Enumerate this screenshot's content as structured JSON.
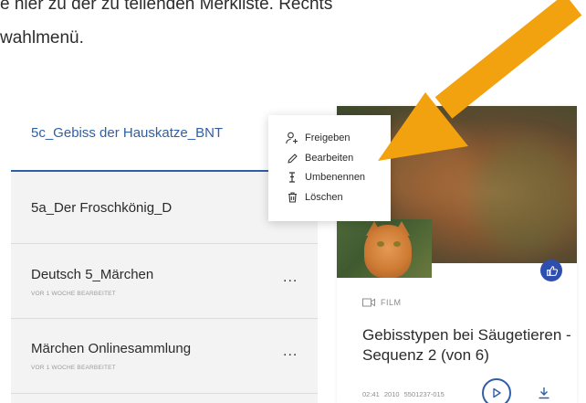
{
  "intro": {
    "line1": "e hier zu der zu teilenden Merkliste. Rechts",
    "line2": "wahlmenü."
  },
  "list": {
    "items": [
      {
        "title": "5c_Gebiss der Hauskatze_BNT",
        "sub": "",
        "active": true
      },
      {
        "title": "5a_Der Froschkönig_D",
        "sub": ""
      },
      {
        "title": "Deutsch 5_Märchen",
        "sub": "VOR 1 WOCHE BEARBEITET",
        "more": "..."
      },
      {
        "title": "Märchen Onlinesammlung",
        "sub": "VOR 1 WOCHE BEARBEITET",
        "more": "..."
      }
    ]
  },
  "menu": {
    "items": [
      {
        "label": "Freigeben",
        "icon": "share-user-icon"
      },
      {
        "label": "Bearbeiten",
        "icon": "pencil-icon"
      },
      {
        "label": "Umbenennen",
        "icon": "text-cursor-icon"
      },
      {
        "label": "Löschen",
        "icon": "trash-icon"
      }
    ]
  },
  "card": {
    "type_label": "FILM",
    "title": "Gebisstypen bei Säugetieren - Sequenz 2 (von 6)",
    "meta": "02:41  2010  5501237-015"
  },
  "colors": {
    "accent_blue": "#2f5fa8",
    "like_blue": "#2f4fb0",
    "arrow_orange": "#f3a20f"
  }
}
